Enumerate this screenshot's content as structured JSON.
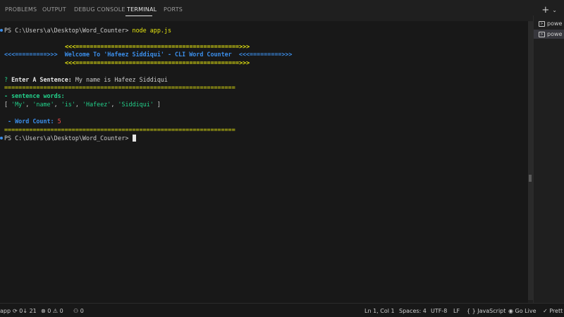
{
  "panel_tabs": [
    "PROBLEMS",
    "OUTPUT",
    "DEBUG CONSOLE",
    "TERMINAL",
    "PORTS"
  ],
  "active_tab": "TERMINAL",
  "actions": {
    "add": "+",
    "dropdown": "⌄"
  },
  "terminal": {
    "prompt": "PS C:\\Users\\a\\Desktop\\Word_Counter>",
    "command": "node app.js",
    "banner_top": "<<<==============================================>>>",
    "banner_left": "<<<=========>>>",
    "banner_title": "Welcome To 'Hafeez Siddiqui' - CLI Word Counter",
    "banner_right": "<<<=========>>>",
    "banner_bottom": "<<<==============================================>>>",
    "question_mark": "?",
    "question_label": "Enter A Sentence:",
    "question_answer": "My name is Hafeez Siddiqui",
    "separator": "=================================================================",
    "words_label": "- sentence words:",
    "words_open": "[",
    "words": [
      "'My'",
      "'name'",
      "'is'",
      "'Hafeez'",
      "'Siddiqui'"
    ],
    "words_close": "]",
    "count_label": " - Word Count:",
    "count_value": "5",
    "prompt2": "PS C:\\Users\\a\\Desktop\\Word_Counter>"
  },
  "side_terminals": [
    "powe",
    "powe"
  ],
  "status": {
    "app": "app",
    "sync": "0↓ 21",
    "errors": "0",
    "warnings": "0",
    "ports": "0",
    "position": "Ln 1, Col 1",
    "spaces": "Spaces: 4",
    "encoding": "UTF-8",
    "eol": "LF",
    "language": "JavaScript",
    "golive": "Go Live",
    "prettier": "Prett"
  }
}
